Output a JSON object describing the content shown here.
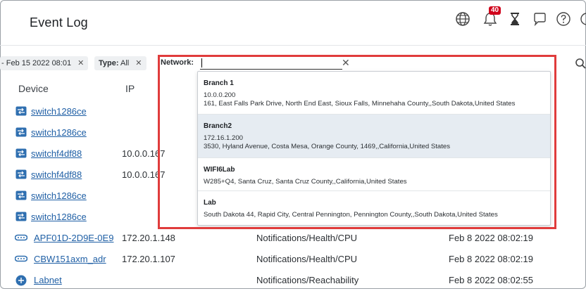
{
  "header": {
    "title": "Event Log",
    "notification_count": "40",
    "icons": [
      "globe-icon",
      "bell-icon",
      "hourglass-icon",
      "chat-icon",
      "help-icon"
    ]
  },
  "filters": {
    "date_chip": "Feb 15 2022 08:01",
    "date_prefix": "-",
    "type_label": "Type:",
    "type_value": "All",
    "network_label": "Network:",
    "network_value": ""
  },
  "table": {
    "columns": {
      "device": "Device",
      "ip": "IP"
    },
    "rows": [
      {
        "device": "switch1286ce",
        "ip": "",
        "category": "",
        "time": "",
        "icon": "switch-icon"
      },
      {
        "device": "switch1286ce",
        "ip": "",
        "category": "",
        "time": "",
        "icon": "switch-icon"
      },
      {
        "device": "switchf4df88",
        "ip": "10.0.0.167",
        "category": "",
        "time": "",
        "icon": "switch-icon"
      },
      {
        "device": "switchf4df88",
        "ip": "10.0.0.167",
        "category": "",
        "time": "",
        "icon": "switch-icon"
      },
      {
        "device": "switch1286ce",
        "ip": "",
        "category": "",
        "time": "",
        "icon": "switch-icon"
      },
      {
        "device": "switch1286ce",
        "ip": "",
        "category": "",
        "time": "",
        "icon": "switch-icon"
      },
      {
        "device": "APF01D-2D9E-0E9",
        "ip": "172.20.1.148",
        "category": "Notifications/Health/CPU",
        "time": "Feb 8 2022 08:02:19",
        "icon": "access-point-icon"
      },
      {
        "device": "CBW151axm_adr",
        "ip": "172.20.1.107",
        "category": "Notifications/Health/CPU",
        "time": "Feb 8 2022 08:02:19",
        "icon": "access-point-icon"
      },
      {
        "device": "Labnet",
        "ip": "",
        "category": "Notifications/Reachability",
        "time": "Feb 8 2022 08:02:55",
        "icon": "network-icon"
      }
    ]
  },
  "dropdown": {
    "options": [
      {
        "name": "Branch 1",
        "line1": "10.0.0.200",
        "line2": "161, East Falls Park Drive, North End East, Sioux Falls, Minnehaha County,,South Dakota,United States",
        "selected": false
      },
      {
        "name": "Branch2",
        "line1": "172.16.1.200",
        "line2": "3530, Hyland Avenue, Costa Mesa, Orange County, 1469,,California,United States",
        "selected": true
      },
      {
        "name": "WIFI6Lab",
        "line1": "W285+Q4, Santa Cruz, Santa Cruz County,,California,United States",
        "line2": "",
        "selected": false
      },
      {
        "name": "Lab",
        "line1": "South Dakota 44, Rapid City, Central Pennington, Pennington County,,South Dakota,United States",
        "line2": "",
        "selected": false
      }
    ]
  },
  "colors": {
    "highlight": "#e03c3c",
    "link": "#1f5fa5",
    "badge": "#d0021b",
    "selected_option": "#e6ecf2"
  }
}
